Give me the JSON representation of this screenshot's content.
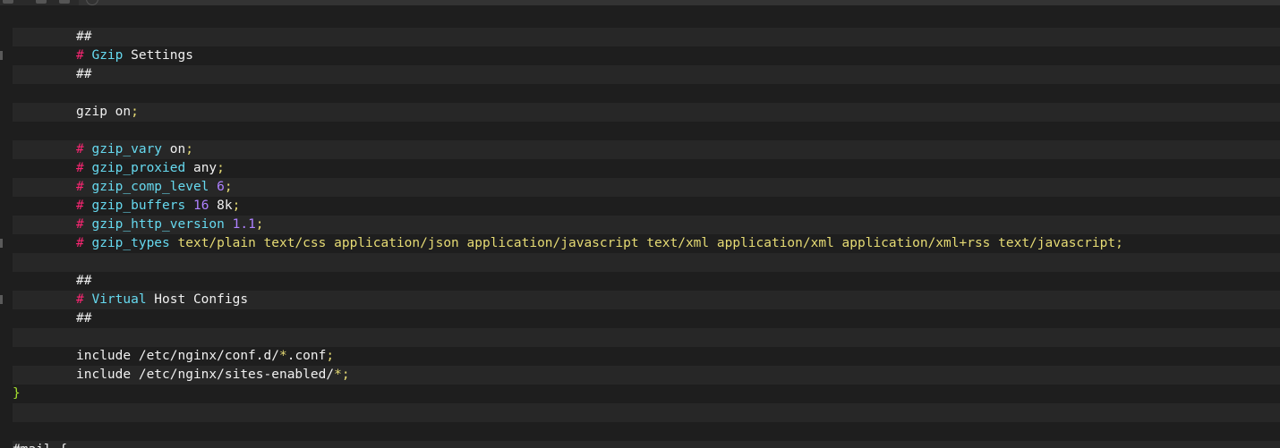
{
  "editor": {
    "lines": [
      {
        "indent": true,
        "tokens": [
          {
            "t": "##",
            "c": "plain"
          }
        ]
      },
      {
        "indent": true,
        "tokens": [
          {
            "t": "# ",
            "c": "hash"
          },
          {
            "t": "Gzip",
            "c": "kw"
          },
          {
            "t": " Settings",
            "c": "plain"
          }
        ]
      },
      {
        "indent": true,
        "tokens": [
          {
            "t": "##",
            "c": "plain"
          }
        ]
      },
      {
        "indent": true,
        "tokens": []
      },
      {
        "indent": true,
        "tokens": [
          {
            "t": "gzip",
            "c": "plain"
          },
          {
            "t": " on",
            "c": "plain"
          },
          {
            "t": ";",
            "c": "punct"
          }
        ]
      },
      {
        "indent": true,
        "tokens": []
      },
      {
        "indent": true,
        "tokens": [
          {
            "t": "# ",
            "c": "hash"
          },
          {
            "t": "gzip_vary",
            "c": "kw"
          },
          {
            "t": " on",
            "c": "plain"
          },
          {
            "t": ";",
            "c": "punct"
          }
        ]
      },
      {
        "indent": true,
        "tokens": [
          {
            "t": "# ",
            "c": "hash"
          },
          {
            "t": "gzip_proxied",
            "c": "kw"
          },
          {
            "t": " any",
            "c": "plain"
          },
          {
            "t": ";",
            "c": "punct"
          }
        ]
      },
      {
        "indent": true,
        "tokens": [
          {
            "t": "# ",
            "c": "hash"
          },
          {
            "t": "gzip_comp_level",
            "c": "kw"
          },
          {
            "t": " 6",
            "c": "num"
          },
          {
            "t": ";",
            "c": "punct"
          }
        ]
      },
      {
        "indent": true,
        "tokens": [
          {
            "t": "# ",
            "c": "hash"
          },
          {
            "t": "gzip_buffers",
            "c": "kw"
          },
          {
            "t": " 16",
            "c": "num"
          },
          {
            "t": " 8k",
            "c": "plain"
          },
          {
            "t": ";",
            "c": "punct"
          }
        ]
      },
      {
        "indent": true,
        "tokens": [
          {
            "t": "# ",
            "c": "hash"
          },
          {
            "t": "gzip_http_version",
            "c": "kw"
          },
          {
            "t": " 1.1",
            "c": "num"
          },
          {
            "t": ";",
            "c": "punct"
          }
        ]
      },
      {
        "indent": true,
        "tokens": [
          {
            "t": "# ",
            "c": "hash"
          },
          {
            "t": "gzip_types",
            "c": "kw"
          },
          {
            "t": " text/plain text/css application/json application/javascript text/xml application/xml application/xml+rss text/javascript",
            "c": "str"
          },
          {
            "t": ";",
            "c": "punct"
          }
        ]
      },
      {
        "indent": true,
        "tokens": []
      },
      {
        "indent": true,
        "tokens": [
          {
            "t": "##",
            "c": "plain"
          }
        ]
      },
      {
        "indent": true,
        "tokens": [
          {
            "t": "# ",
            "c": "hash"
          },
          {
            "t": "Virtual",
            "c": "kw"
          },
          {
            "t": " Host Configs",
            "c": "plain"
          }
        ]
      },
      {
        "indent": true,
        "tokens": [
          {
            "t": "##",
            "c": "plain"
          }
        ]
      },
      {
        "indent": true,
        "tokens": []
      },
      {
        "indent": true,
        "tokens": [
          {
            "t": "include",
            "c": "plain"
          },
          {
            "t": " /etc/nginx/conf.d/",
            "c": "plain"
          },
          {
            "t": "*",
            "c": "star"
          },
          {
            "t": ".conf",
            "c": "plain"
          },
          {
            "t": ";",
            "c": "punct"
          }
        ]
      },
      {
        "indent": true,
        "tokens": [
          {
            "t": "include",
            "c": "plain"
          },
          {
            "t": " /etc/nginx/sites-enabled/",
            "c": "plain"
          },
          {
            "t": "*",
            "c": "star"
          },
          {
            "t": ";",
            "c": "punct"
          }
        ]
      },
      {
        "indent": false,
        "tokens": [
          {
            "t": "}",
            "c": "brace"
          }
        ]
      },
      {
        "indent": true,
        "tokens": []
      },
      {
        "indent": true,
        "tokens": []
      },
      {
        "indent": false,
        "tokens": [
          {
            "t": "#mail {",
            "c": "plain"
          }
        ]
      }
    ]
  }
}
